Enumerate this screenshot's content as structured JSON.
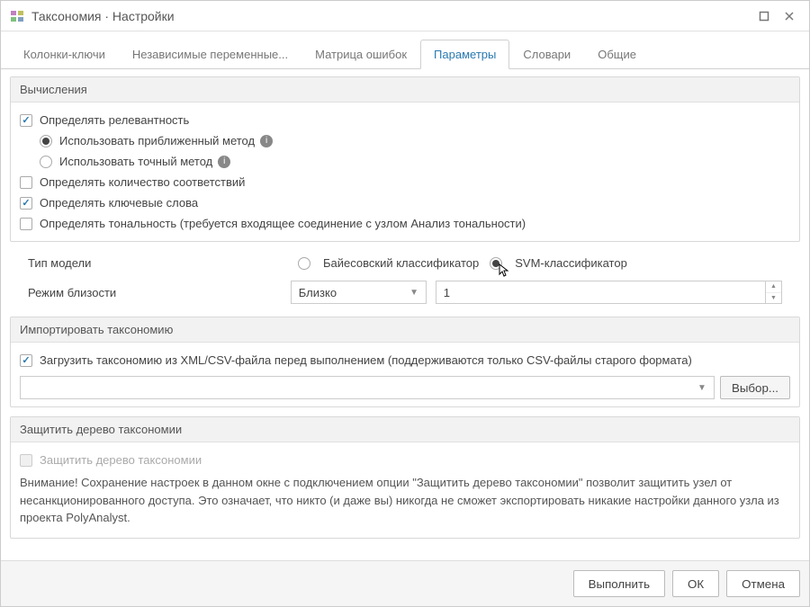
{
  "window": {
    "title": "Таксономия · Настройки"
  },
  "tabs": [
    {
      "label": "Колонки-ключи"
    },
    {
      "label": "Независимые переменные..."
    },
    {
      "label": "Матрица ошибок"
    },
    {
      "label": "Параметры"
    },
    {
      "label": "Словари"
    },
    {
      "label": "Общие"
    }
  ],
  "computations": {
    "header": "Вычисления",
    "relevance": "Определять релевантность",
    "approx": "Использовать приближенный метод",
    "exact": "Использовать точный метод",
    "matches": "Определять количество соответствий",
    "keywords": "Определять ключевые слова",
    "tonality": "Определять тональность (требуется входящее соединение с узлом Анализ тональности)"
  },
  "model": {
    "type_label": "Тип модели",
    "bayes": "Байесовский классификатор",
    "svm": "SVM-классификатор"
  },
  "proximity": {
    "label": "Режим близости",
    "select_value": "Близко",
    "number_value": "1"
  },
  "import": {
    "header": "Импортировать таксономию",
    "load_label": "Загрузить таксономию из XML/CSV-файла перед выполнением (поддерживаются только CSV-файлы старого формата)",
    "browse": "Выбор..."
  },
  "protect": {
    "header": "Защитить дерево таксономии",
    "checkbox": "Защитить дерево таксономии",
    "warning": "Внимание! Сохранение настроек в данном окне с подключением опции \"Защитить дерево таксономии\" позволит защитить узел от несанкционированного доступа. Это означает, что никто (и даже вы) никогда не сможет экспортировать никакие настройки данного узла из проекта PolyAnalyst."
  },
  "footer": {
    "run": "Выполнить",
    "ok": "ОК",
    "cancel": "Отмена"
  }
}
